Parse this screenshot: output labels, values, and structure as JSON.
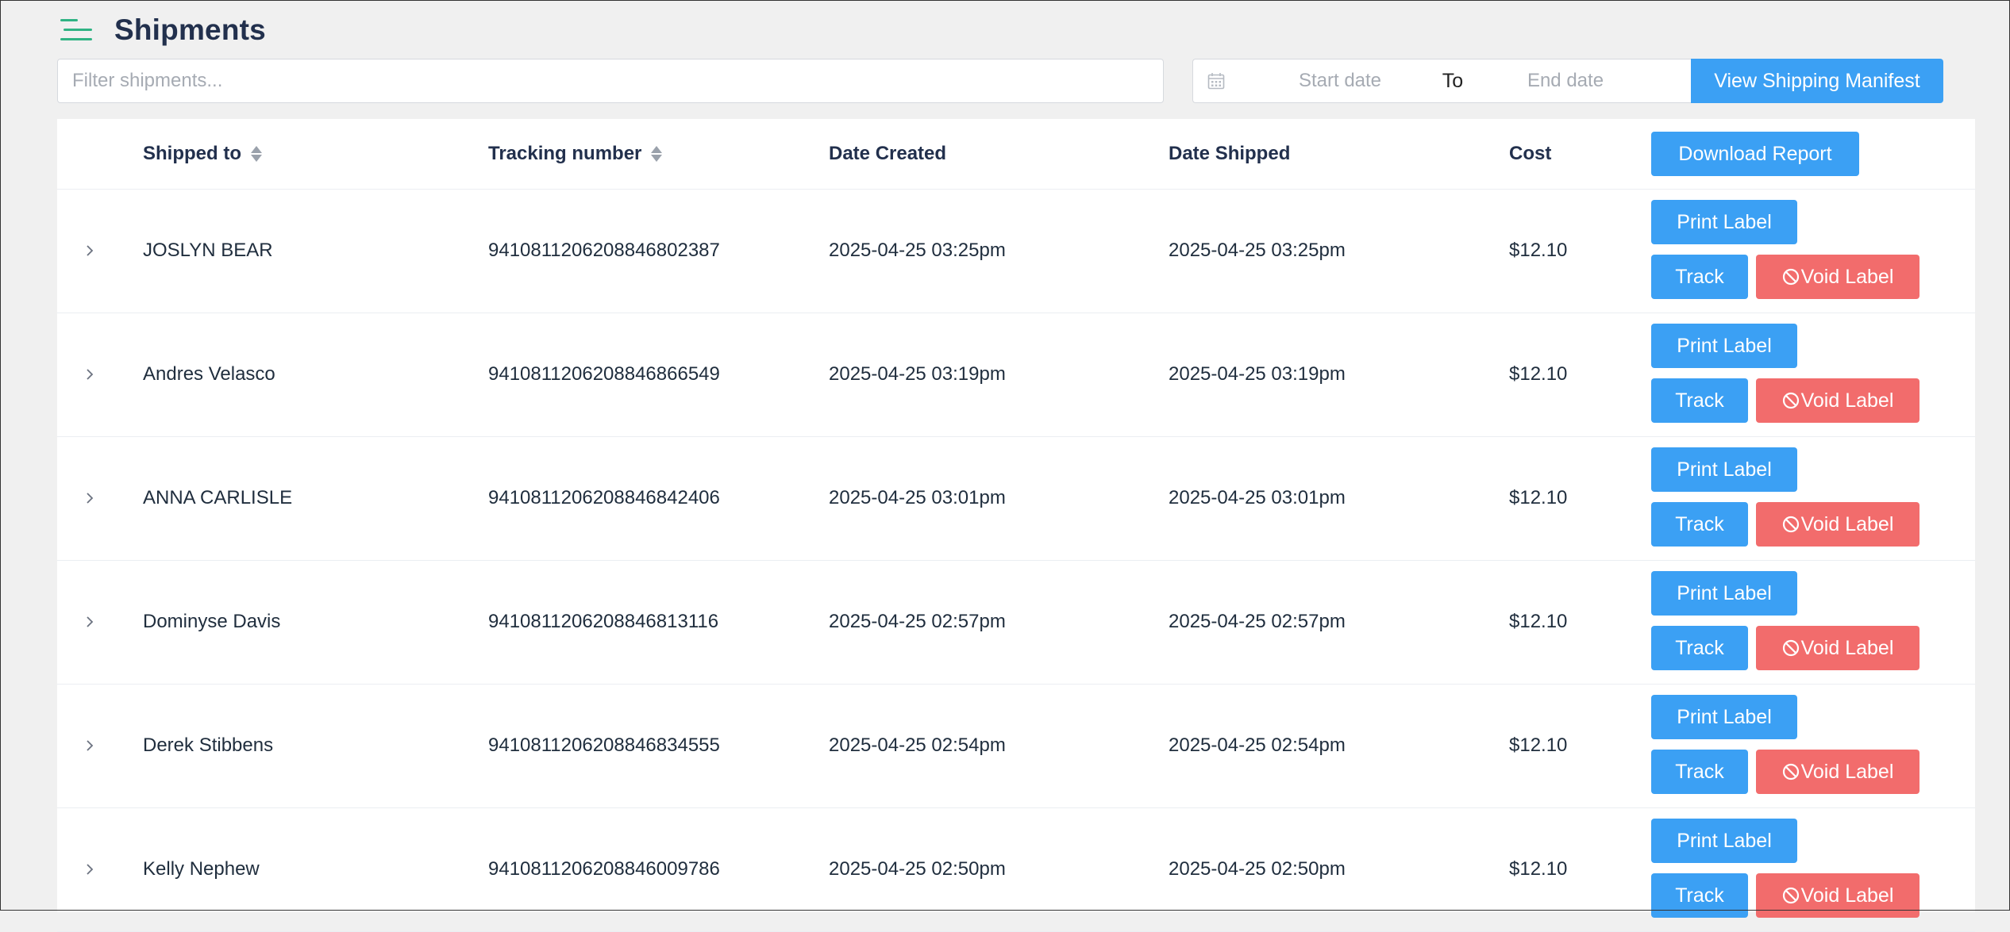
{
  "header": {
    "title": "Shipments",
    "menu_icon": "hamburger-menu-icon"
  },
  "filters": {
    "search_placeholder": "Filter shipments...",
    "start_date_placeholder": "Start date",
    "separator": "To",
    "end_date_placeholder": "End date",
    "manifest_button": "View Shipping Manifest"
  },
  "table": {
    "columns": {
      "shipped_to": "Shipped to",
      "tracking_number": "Tracking number",
      "date_created": "Date Created",
      "date_shipped": "Date Shipped",
      "cost": "Cost"
    },
    "download_button": "Download Report",
    "actions": {
      "print": "Print Label",
      "track": "Track",
      "void": "Void Label"
    },
    "rows": [
      {
        "name": "JOSLYN BEAR",
        "tracking": "9410811206208846802387",
        "created": "2025-04-25 03:25pm",
        "shipped": "2025-04-25 03:25pm",
        "cost": "$12.10"
      },
      {
        "name": "Andres Velasco",
        "tracking": "9410811206208846866549",
        "created": "2025-04-25 03:19pm",
        "shipped": "2025-04-25 03:19pm",
        "cost": "$12.10"
      },
      {
        "name": "ANNA CARLISLE",
        "tracking": "9410811206208846842406",
        "created": "2025-04-25 03:01pm",
        "shipped": "2025-04-25 03:01pm",
        "cost": "$12.10"
      },
      {
        "name": "Dominyse Davis",
        "tracking": "9410811206208846813116",
        "created": "2025-04-25 02:57pm",
        "shipped": "2025-04-25 02:57pm",
        "cost": "$12.10"
      },
      {
        "name": "Derek Stibbens",
        "tracking": "9410811206208846834555",
        "created": "2025-04-25 02:54pm",
        "shipped": "2025-04-25 02:54pm",
        "cost": "$12.10"
      },
      {
        "name": "Kelly Nephew",
        "tracking": "9410811206208846009786",
        "created": "2025-04-25 02:50pm",
        "shipped": "2025-04-25 02:50pm",
        "cost": "$12.10"
      }
    ]
  },
  "colors": {
    "accent_green": "#2fb383",
    "button_blue": "#3ba0f4",
    "button_red": "#f26c6c",
    "title": "#22304d"
  }
}
